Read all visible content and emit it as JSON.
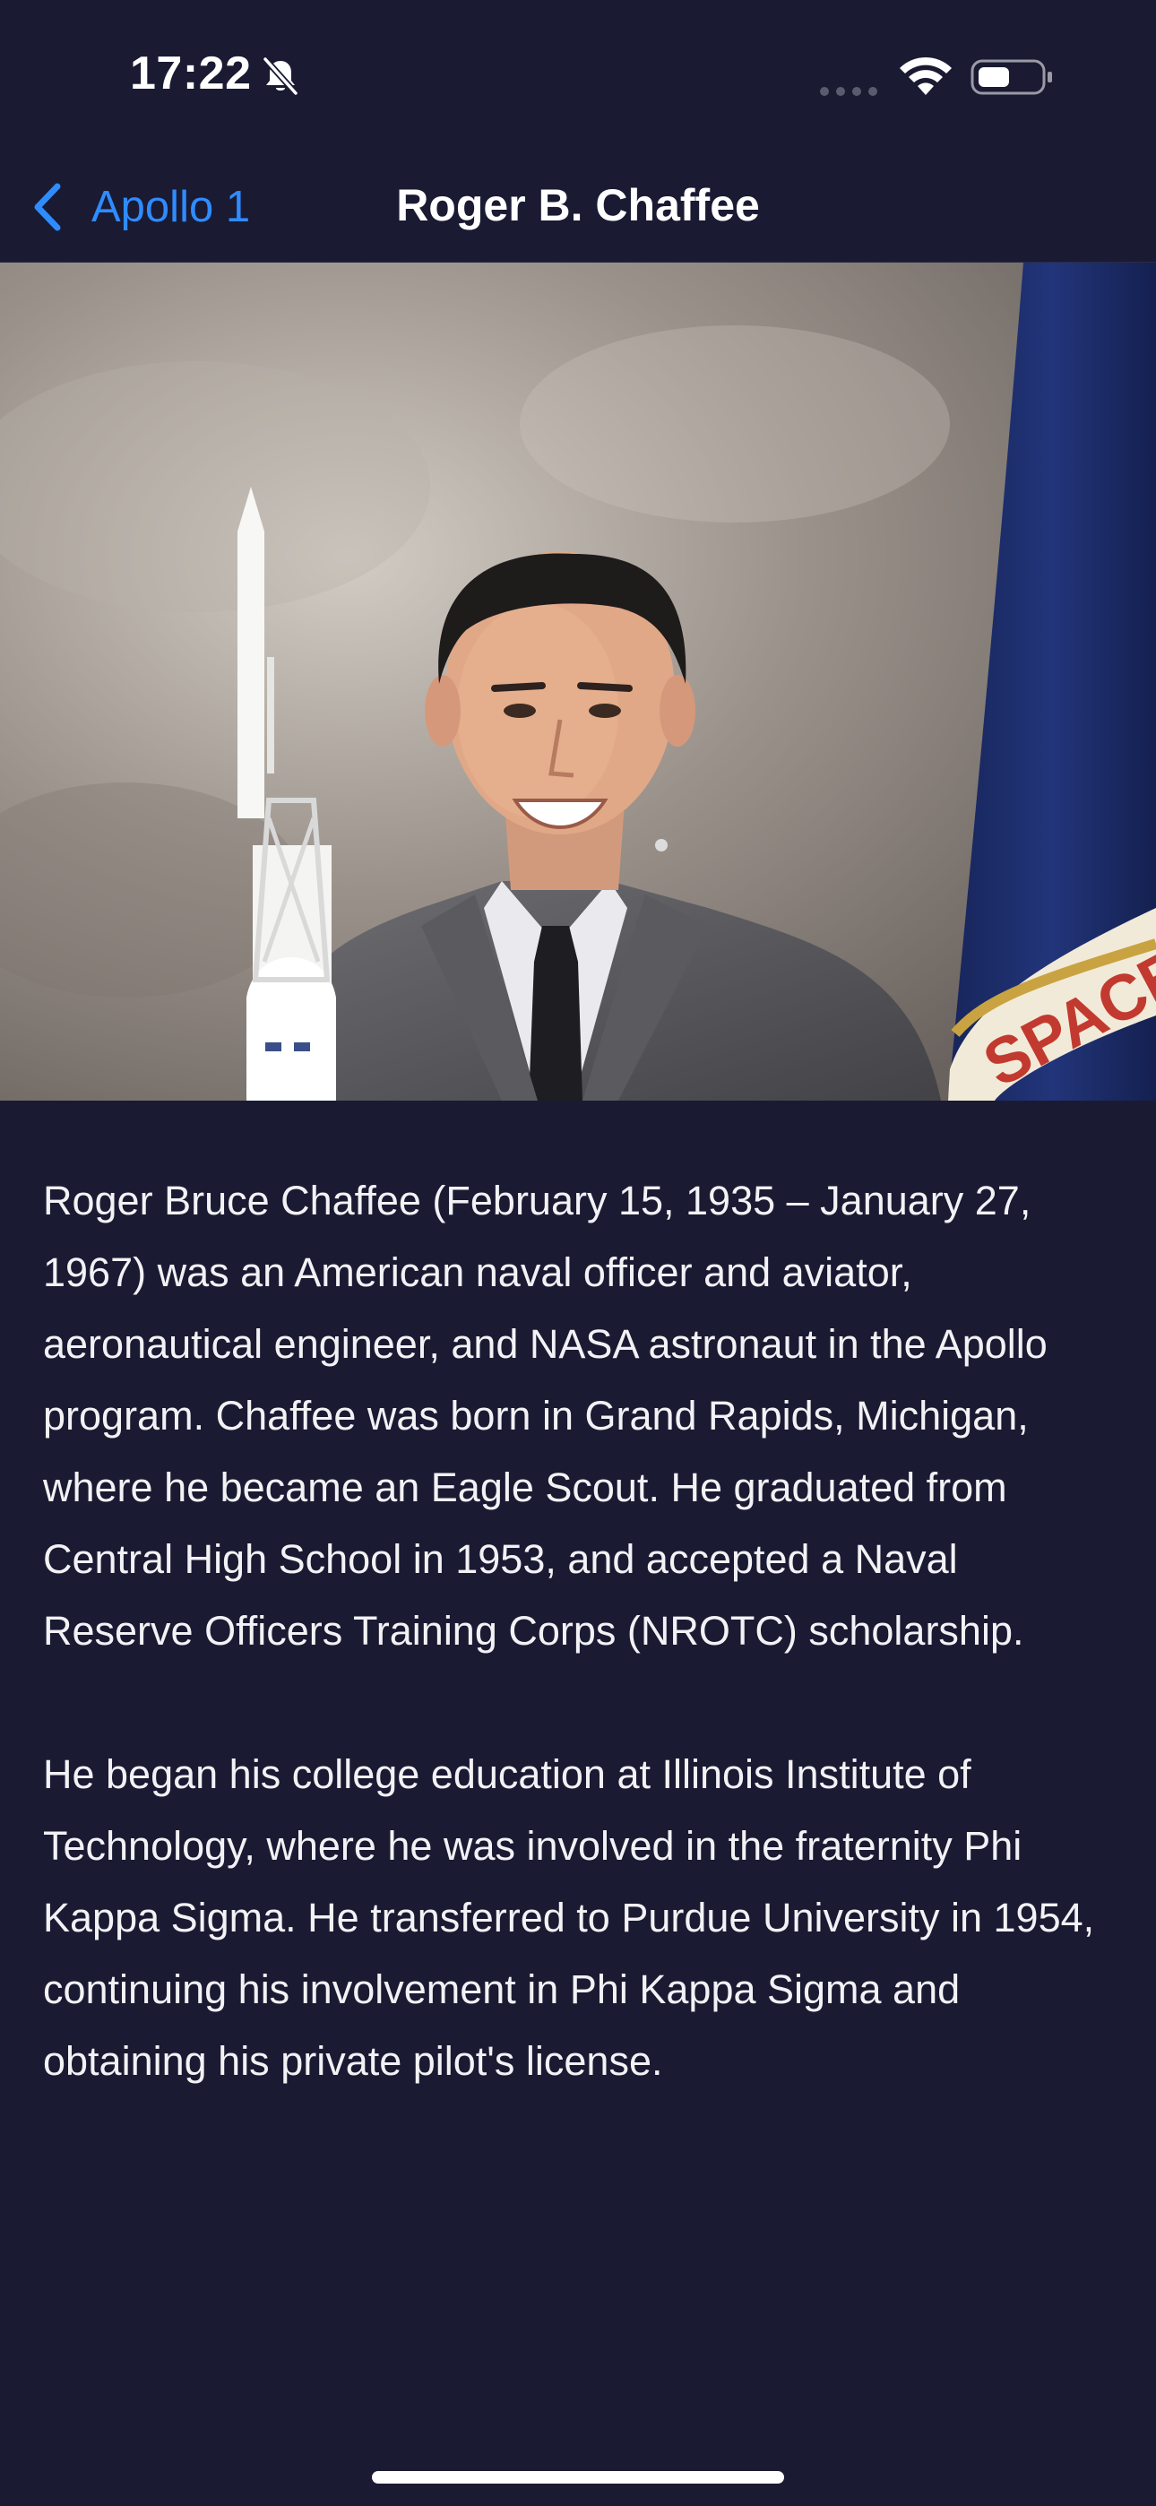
{
  "status_bar": {
    "time": "17:22",
    "icons": [
      "bell-slash-icon",
      "cellular-signal-icon",
      "wifi-icon",
      "battery-icon"
    ]
  },
  "nav": {
    "back_label": "Apollo 1",
    "title": "Roger B. Chaffee"
  },
  "hero_image": {
    "subject": "portrait-photo"
  },
  "content": {
    "paragraphs": [
      "Roger Bruce Chaffee (February 15, 1935 – January 27, 1967) was an American naval officer and aviator, aeronautical engineer, and NASA astronaut in the Apollo program. Chaffee was born in Grand Rapids, Michigan, where he became an Eagle Scout. He graduated from Central High School in 1953, and accepted a Naval Reserve Officers Training Corps (NROTC) scholarship.",
      "He began his college education at Illinois Institute of Technology, where he was involved in the fraternity Phi Kappa Sigma. He transferred to Purdue University in 1954, continuing his involvement in Phi Kappa Sigma and obtaining his private pilot's license."
    ]
  },
  "colors": {
    "background": "#1a1a33",
    "accent": "#2f8cff",
    "text": "#ffffff"
  }
}
